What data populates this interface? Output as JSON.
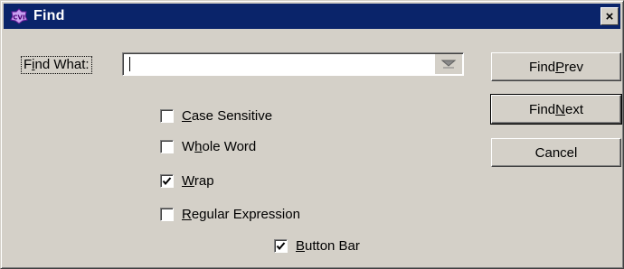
{
  "window": {
    "title": "Find",
    "icon": "cvi-app-icon",
    "close_label": "×"
  },
  "find_what": {
    "label_before": "F",
    "label_mnemonic": "i",
    "label_after": "nd What:",
    "value": "",
    "placeholder": ""
  },
  "buttons": {
    "find_prev": {
      "before": "Find ",
      "mnemonic": "P",
      "after": "rev"
    },
    "find_next": {
      "before": "Find ",
      "mnemonic": "N",
      "after": "ext"
    },
    "cancel": {
      "label": "Cancel"
    }
  },
  "options": {
    "case_sensitive": {
      "checked": false,
      "before": "",
      "mnemonic": "C",
      "after": "ase Sensitive"
    },
    "whole_word": {
      "checked": false,
      "before": "W",
      "mnemonic": "h",
      "after": "ole Word"
    },
    "wrap": {
      "checked": true,
      "before": "",
      "mnemonic": "W",
      "after": "rap"
    },
    "regular_expression": {
      "checked": false,
      "before": "",
      "mnemonic": "R",
      "after": "egular Expression"
    },
    "button_bar": {
      "checked": true,
      "before": "",
      "mnemonic": "B",
      "after": "utton Bar"
    }
  },
  "colors": {
    "titlebar": "#0a246a",
    "face": "#d4d0c8"
  }
}
